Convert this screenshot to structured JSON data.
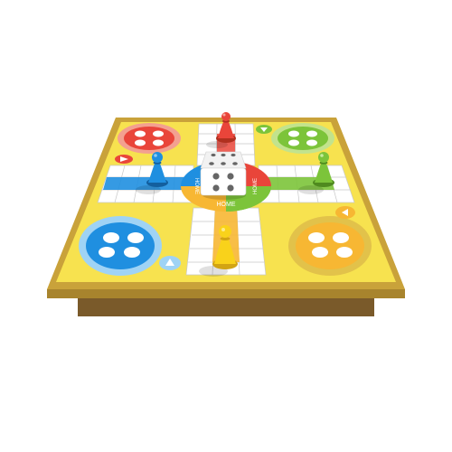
{
  "board": {
    "center_label": "HOME",
    "colors": {
      "red": "#e9453a",
      "green": "#7cc43a",
      "blue": "#1f8fe0",
      "yellow": "#f7b733",
      "board_top": "#f7e24f",
      "board_frame": "#c9a23a",
      "board_edge": "#a8842d",
      "stand": "#7a5a2a"
    },
    "corners": [
      {
        "name": "red",
        "pieces_in_base": 4
      },
      {
        "name": "green",
        "pieces_in_base": 4
      },
      {
        "name": "blue",
        "pieces_in_base": 4
      },
      {
        "name": "yellow",
        "pieces_in_base": 4
      }
    ],
    "pawns_on_track": [
      "red",
      "blue",
      "green",
      "yellow"
    ],
    "arrows": [
      "red",
      "green",
      "blue",
      "yellow"
    ]
  },
  "dice": {
    "visible_face_value": 6,
    "side_face_value": 4
  }
}
